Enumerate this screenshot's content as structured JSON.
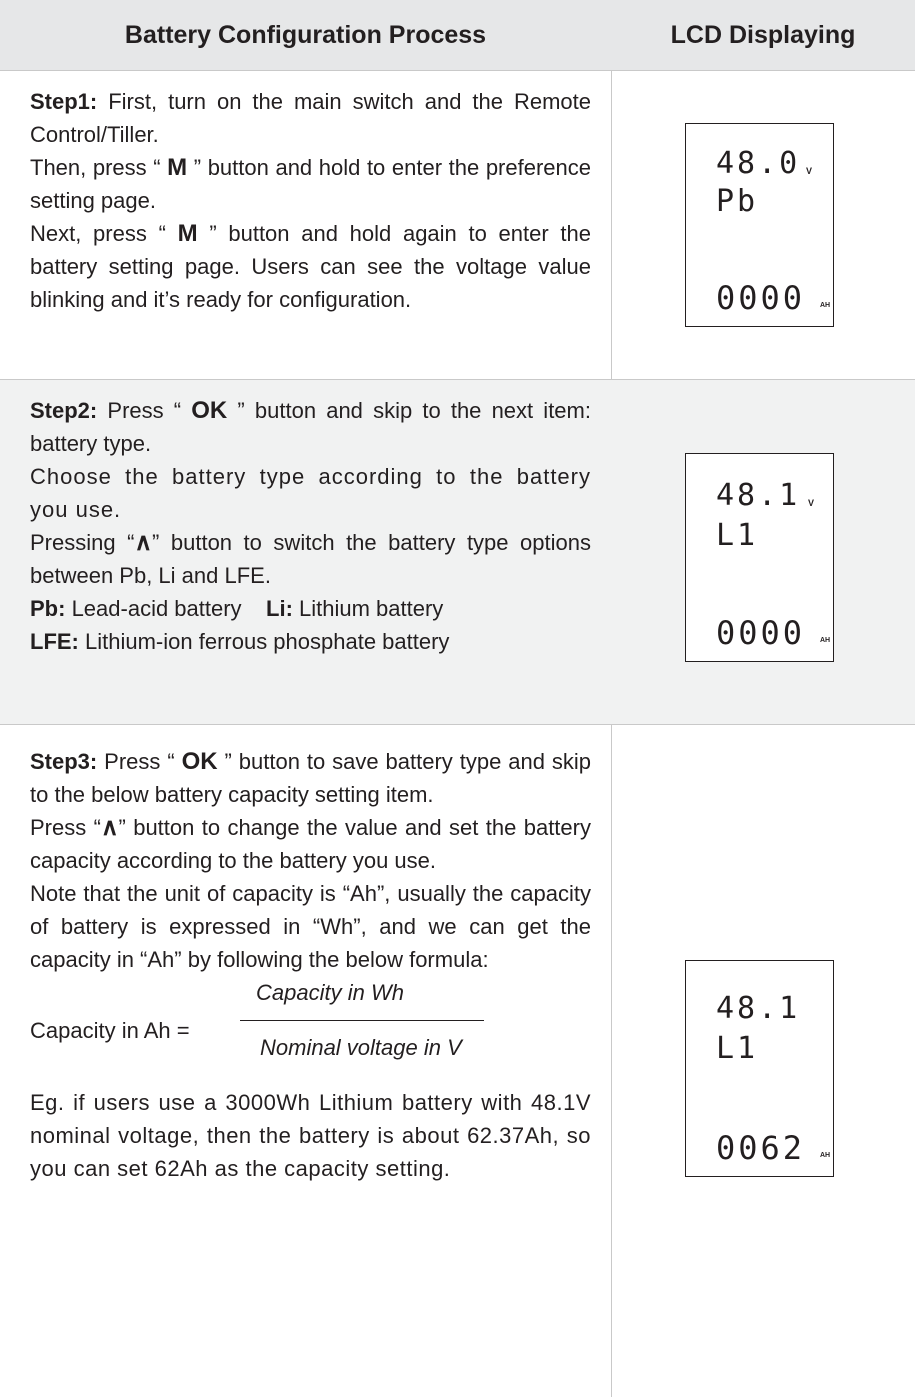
{
  "header": {
    "col1": "Battery Configuration Process",
    "col2": "LCD Displaying"
  },
  "step1": {
    "label": "Step1:",
    "line1": " First, turn on the main switch and the Remote Control/Tiller.",
    "line2a": "Then, press “ ",
    "button": "M",
    "line2b": " ” button and hold to enter the preference setting page.",
    "line3a": "Next, press “ ",
    "line3b": " ” button and hold again to enter the battery setting page. Users can see the voltage value blinking and it’s ready for configuration.",
    "lcd": {
      "voltage": "48.0",
      "voltage_unit": "V",
      "type": "Pb",
      "capacity": "0000",
      "capacity_unit": "AH"
    }
  },
  "step2": {
    "label": "Step2:",
    "line1a": " Press “ ",
    "ok_button": "OK",
    "line1b": " ” button and skip to the next item: battery type.",
    "line2": "Choose the battery type according to the battery you use.",
    "line3a": "Pressing “",
    "up_button": "∧",
    "line3b": "” button to switch the battery type options between Pb, Li and LFE.",
    "pb_label": "Pb:",
    "pb_text": "  Lead-acid battery",
    "li_label": "Li:",
    "li_text": " Lithium battery",
    "lfe_label": "LFE:",
    "lfe_text": " Lithium-ion ferrous phosphate battery",
    "lcd": {
      "voltage": "48.1",
      "voltage_unit": "V",
      "type": "L1",
      "capacity": "0000",
      "capacity_unit": "AH"
    }
  },
  "step3": {
    "label": "Step3:",
    "line1a": " Press “ ",
    "ok_button": "OK",
    "line1b": " ” button to save battery type and skip to the below battery capacity setting item.",
    "line2a": "Press “",
    "up_button": "∧",
    "line2b": "”  button to change the value and set the battery capacity according to the battery you use.",
    "line3": "Note that the unit of capacity is “Ah”, usually the capacity of battery is expressed in “Wh”, and we can get the capacity in “Ah” by following the below formula:",
    "formula_lhs": "Capacity in Ah  =",
    "formula_num": "Capacity in Wh",
    "formula_den": "Nominal voltage in V",
    "line4": "Eg. if users use a 3000Wh Lithium battery with  48.1V nominal voltage, then the battery is about 62.37Ah, so you can set 62Ah as the capacity setting.",
    "lcd": {
      "voltage": "48.1",
      "type": "L1",
      "capacity": "0062",
      "capacity_unit": "AH"
    }
  }
}
